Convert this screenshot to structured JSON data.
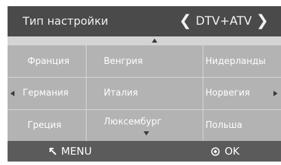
{
  "header": {
    "title": "Тип настройки",
    "mode": "DTV+ATV",
    "prev_icon": "chevron-left-icon",
    "next_icon": "chevron-right-icon"
  },
  "countries": {
    "row1": [
      "Франция",
      "Венгрия",
      "Нидерланды"
    ],
    "row2": [
      "Германия",
      "Италия",
      "Норвегия"
    ],
    "row3": [
      "Греция",
      "Люксембург",
      "Польша"
    ]
  },
  "footer": {
    "menu_label": "MENU",
    "ok_label": "OK",
    "menu_icon": "return-arrow-icon",
    "ok_icon": "ok-circle-icon"
  },
  "colors": {
    "header_bg": "#4a4a4a",
    "grid_bg": "#b3b3b3",
    "footer_bg": "#5b5b5b",
    "text": "#ffffff"
  }
}
